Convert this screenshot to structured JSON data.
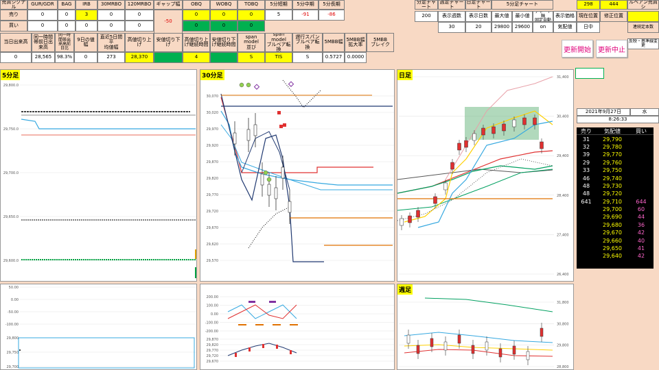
{
  "signal_header": {
    "title": "売買シグナル",
    "gur_gdr": "GUR/GDR",
    "bag": "BAG",
    "irb": "IRB",
    "mrbo30": "30MRBO",
    "mrbo120": "120MRBO",
    "gap": "ギャップ幅",
    "obq": "OBQ",
    "wobq": "WOBQ",
    "tobq": "TOBQ",
    "short5": "5分短期",
    "mid5": "5分中期",
    "long5": "5分長期"
  },
  "row_sell": {
    "label": "売り",
    "v1": "0",
    "v2": "0",
    "v3": "3",
    "v4": "0",
    "v5": "0",
    "obq": "0",
    "wobq": "0",
    "tobq": "0",
    "short5": "5",
    "mid5": "-91",
    "long5": "-86"
  },
  "row_buy": {
    "label": "買い",
    "v1": "0",
    "v2": "0",
    "v3": "0",
    "v4": "0",
    "v5": "0",
    "gap": "-50",
    "obq": "0",
    "wobq": "0",
    "tobq": "0"
  },
  "metrics_header": {
    "a": "当日出来高",
    "b": "同一時間\n帯前日出\n来高",
    "c": "同一時\n間帯出\n来高前\n日比",
    "d": "9日の値幅",
    "e": "直近5日間平\n均値幅",
    "f": "高値切り上\nげ",
    "g": "安値切り下\nげ",
    "h": "高値切り上\nげ継続時間",
    "i": "安値切り下\nげ継続時間",
    "j": "span model\n並び",
    "k": "span model\nブルベア転\n換",
    "l": "遅行スパン\nブルベア転\n換",
    "m": "5MBB幅",
    "n": "5MBB幅\n拡大率",
    "o": "5MBB\nブレイク"
  },
  "metrics_values": {
    "a": "0",
    "b": "28,565",
    "c": "98.3%",
    "d": "0",
    "e": "273",
    "f": "28,370",
    "h": "4",
    "j": "S",
    "k": "TIS",
    "l": "S",
    "m": "0.5727",
    "n": "0.0000"
  },
  "settings": {
    "h1": "分足チャート",
    "h2": "週足チャート",
    "h3": "日足チャート",
    "h4": "5分足チャート",
    "l1": "表示週数",
    "l2": "表示日数",
    "l3": "最大値",
    "l4": "最小値",
    "l5": "チャート軸\n固定自動",
    "l6": "表示価格",
    "v0": "200",
    "v1": "30",
    "v2": "20",
    "v3": "29800",
    "v4": "29600",
    "v5": "on",
    "v6": "気配値"
  },
  "status": {
    "now_label": "現在位置",
    "fix_label": "修正位置",
    "now_value": "298",
    "fix_value": "444",
    "bullbear_label": "ルベアン売買シ",
    "session": "日中",
    "trend_def": "連続定本数",
    "hint": "反映・基準線変更"
  },
  "buttons": {
    "start": "更新開始",
    "stop": "更新中止"
  },
  "clock": {
    "date": "2021年9月27日",
    "weekday": "水",
    "time": "8:26:33"
  },
  "board": {
    "h_sell": "売り",
    "h_price": "気配値",
    "h_buy": "買い",
    "rows": [
      {
        "sell": "31",
        "price": "29,790",
        "buy": ""
      },
      {
        "sell": "32",
        "price": "29,780",
        "buy": ""
      },
      {
        "sell": "39",
        "price": "29,770",
        "buy": ""
      },
      {
        "sell": "29",
        "price": "29,760",
        "buy": ""
      },
      {
        "sell": "33",
        "price": "29,750",
        "buy": ""
      },
      {
        "sell": "46",
        "price": "29,740",
        "buy": ""
      },
      {
        "sell": "48",
        "price": "29,730",
        "buy": ""
      },
      {
        "sell": "48",
        "price": "29,720",
        "buy": ""
      },
      {
        "sell": "641",
        "price": "29,710",
        "buy": "644"
      },
      {
        "sell": "",
        "price": "29,700",
        "buy": "60"
      },
      {
        "sell": "",
        "price": "29,690",
        "buy": "44"
      },
      {
        "sell": "",
        "price": "29,680",
        "buy": "36"
      },
      {
        "sell": "",
        "price": "29,670",
        "buy": "42"
      },
      {
        "sell": "",
        "price": "29,660",
        "buy": "40"
      },
      {
        "sell": "",
        "price": "29,650",
        "buy": "41"
      },
      {
        "sell": "",
        "price": "29,640",
        "buy": "42"
      }
    ]
  },
  "charts": {
    "min5": {
      "title": "5分足",
      "ticks": [
        "29,800.0",
        "29,750.0",
        "29,700.0",
        "29,650.0",
        "29,600.0"
      ]
    },
    "min30": {
      "title": "30分足",
      "ticks": [
        "30,070",
        "30,020",
        "29,970",
        "29,920",
        "29,870",
        "29,820",
        "29,770",
        "29,720",
        "29,670",
        "29,620",
        "29,570"
      ]
    },
    "daily": {
      "title": "日足",
      "ticks": [
        "31,400",
        "30,400",
        "29,400",
        "28,400",
        "27,400",
        "26,400"
      ]
    },
    "osc": {
      "ticks": [
        "50.00",
        "0.00",
        "-50.00",
        "-100.00"
      ]
    },
    "mini": {
      "ticks": [
        "29,800",
        "29,750",
        "29,700"
      ]
    },
    "osc30": {
      "ticks": [
        "200.00",
        "100.00",
        "0.00",
        "-100.00",
        "-200.00"
      ]
    },
    "mini30": {
      "ticks": [
        "29,870",
        "29,820",
        "29,770",
        "29,720",
        "29,670"
      ]
    },
    "weekly": {
      "title": "週足",
      "ticks": [
        "31,800",
        "30,800",
        "29,800",
        "28,800"
      ]
    }
  },
  "colors": {
    "accent": "#ffff00",
    "green": "#00b050",
    "light_green": "#92d050",
    "board_bg": "#000000",
    "button_text": "#e0007a"
  }
}
